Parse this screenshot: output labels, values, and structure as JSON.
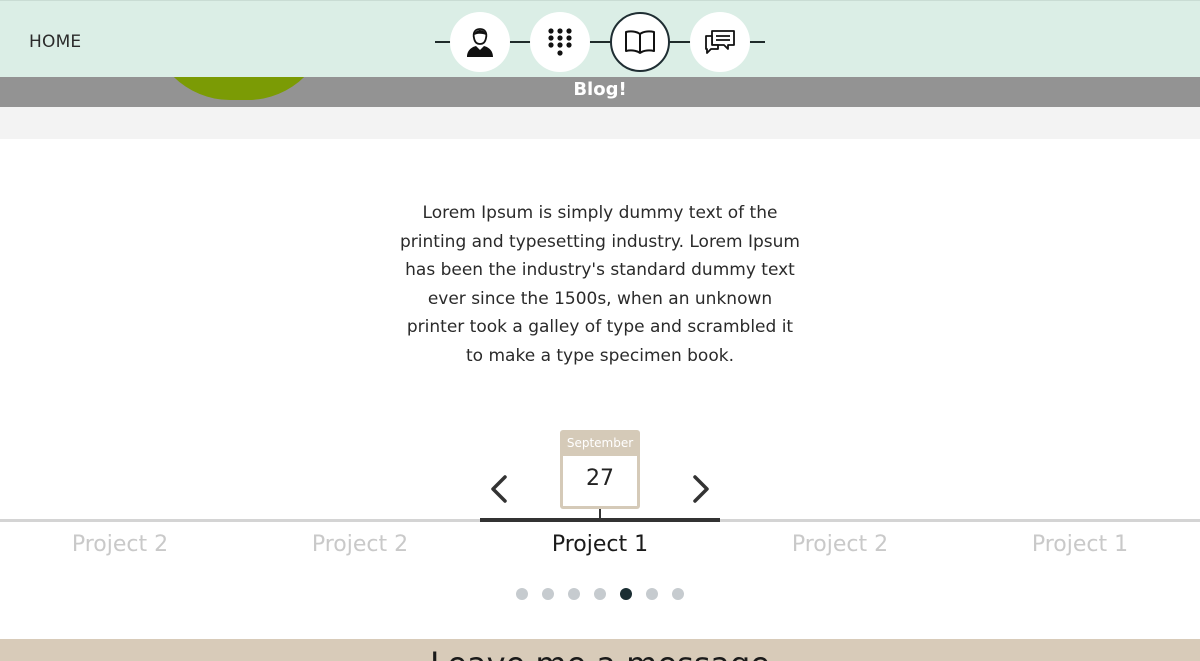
{
  "header": {
    "home_label": "HOME",
    "nav": [
      {
        "icon": "user-icon",
        "active": false
      },
      {
        "icon": "keypad-icon",
        "active": false
      },
      {
        "icon": "book-icon",
        "active": true
      },
      {
        "icon": "chat-icon",
        "active": false
      }
    ]
  },
  "blog": {
    "title": "Blog!"
  },
  "content": {
    "text": "Lorem Ipsum is simply dummy text of the printing and typesetting industry. Lorem Ipsum has been the industry's standard dummy text ever since the 1500s, when an unknown printer took a galley of type and scrambled it to make a type specimen book."
  },
  "timeline": {
    "month": "September",
    "day": "27",
    "projects": [
      {
        "label": "Project 2",
        "active": false
      },
      {
        "label": "Project 2",
        "active": false
      },
      {
        "label": "Project 1",
        "active": true
      },
      {
        "label": "Project 2",
        "active": false
      },
      {
        "label": "Project 1",
        "active": false
      }
    ],
    "dots_total": 7,
    "dots_active_index": 4
  },
  "footer": {
    "title": "Leave me a message"
  },
  "colors": {
    "header_bg": "#dbeee6",
    "accent_green": "#7b9b05",
    "blog_bar": "#939393",
    "calendar": "#d5cab8",
    "active_dark": "#1b2e33"
  }
}
